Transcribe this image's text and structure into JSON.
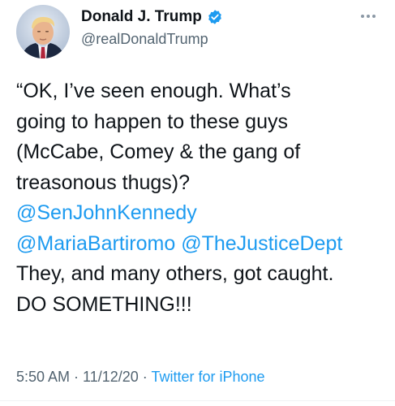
{
  "author": {
    "name": "Donald J. Trump",
    "handle": "@realDonaldTrump",
    "verified": true
  },
  "tweet": {
    "lines": [
      {
        "segments": [
          {
            "text": "“OK, I’ve seen enough. What’s",
            "type": "text"
          }
        ]
      },
      {
        "segments": [
          {
            "text": "going to happen to these guys",
            "type": "text"
          }
        ]
      },
      {
        "segments": [
          {
            "text": "(McCabe, Comey & the gang of",
            "type": "text"
          }
        ]
      },
      {
        "segments": [
          {
            "text": "treasonous thugs)?",
            "type": "text"
          }
        ]
      },
      {
        "segments": [
          {
            "text": "@SenJohnKennedy",
            "type": "mention"
          }
        ]
      },
      {
        "segments": [
          {
            "text": "@MariaBartiromo",
            "type": "mention"
          },
          {
            "text": " ",
            "type": "text"
          },
          {
            "text": "@TheJusticeDept",
            "type": "mention"
          }
        ]
      },
      {
        "segments": [
          {
            "text": "They, and many others, got caught.",
            "type": "text"
          }
        ]
      },
      {
        "segments": [
          {
            "text": "DO SOMETHING!!!",
            "type": "text"
          }
        ]
      }
    ]
  },
  "meta": {
    "time": "5:50 AM",
    "separator": " · ",
    "date": "11/12/20",
    "source": "Twitter for iPhone"
  },
  "icons": {
    "verified": "verified-badge-icon",
    "more": "more-options-icon"
  },
  "colors": {
    "link": "#1d9bf0",
    "text": "#0f1419",
    "secondary": "#536471",
    "verified": "#1d9bf0"
  }
}
